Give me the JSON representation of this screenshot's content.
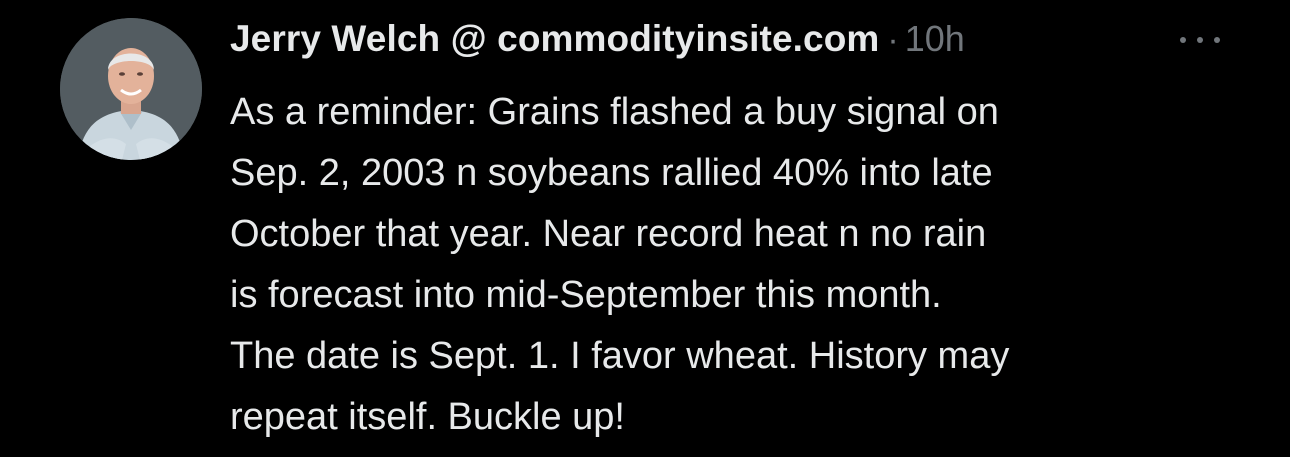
{
  "author": {
    "display_name": "Jerry Welch @ commodityinsite.com",
    "avatar_icon": "profile-photo"
  },
  "meta": {
    "separator": "·",
    "timestamp": "10h",
    "more_icon": "more-horizontal-icon"
  },
  "tweet": {
    "lines": [
      "As a reminder: Grains flashed a buy signal on",
      "Sep. 2, 2003 n soybeans rallied 40% into late",
      "October that year. Near record heat n no rain",
      "is forecast into mid-September this month.",
      "The date is Sept. 1. I favor wheat. History may",
      "repeat itself. Buckle up!"
    ]
  },
  "colors": {
    "background": "#000000",
    "primary_text": "#e7e9ea",
    "secondary_text": "#71767b"
  }
}
